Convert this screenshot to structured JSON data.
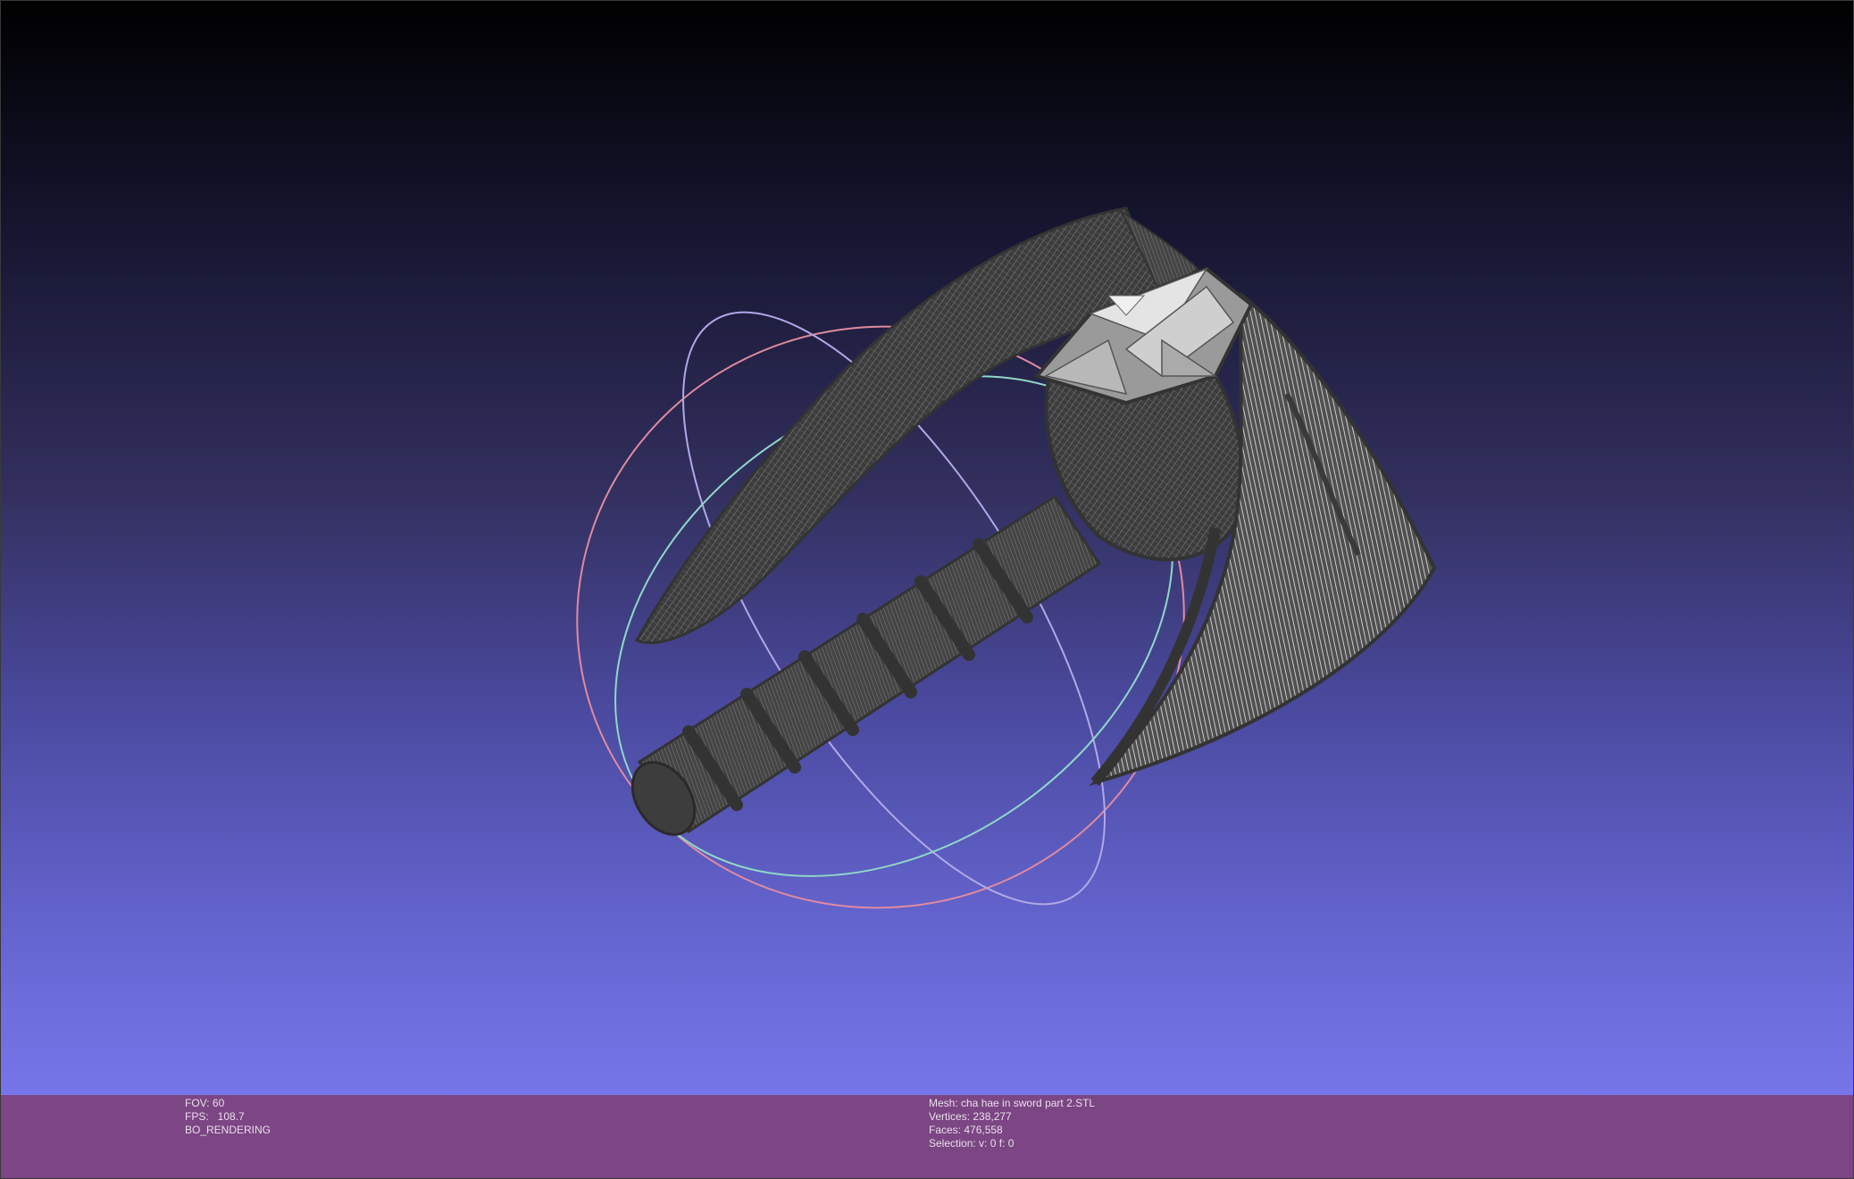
{
  "viewport": {
    "background_top": "#000000",
    "background_bottom": "#7676ea",
    "model_color": "#4a4a4a",
    "trackball_colors": [
      "#e08aa0",
      "#b0a8e8",
      "#8fd8c8",
      "#8a8a8a"
    ]
  },
  "info": {
    "bar_color": "#7c4584",
    "fov": "FOV: 60",
    "fps": "FPS:   108.7",
    "rendering": "BO_RENDERING",
    "mesh": "Mesh: cha hae in sword part 2.STL",
    "vertices": "Vertices: 238,277",
    "faces": "Faces: 476,558",
    "selection": "Selection: v: 0 f: 0"
  }
}
